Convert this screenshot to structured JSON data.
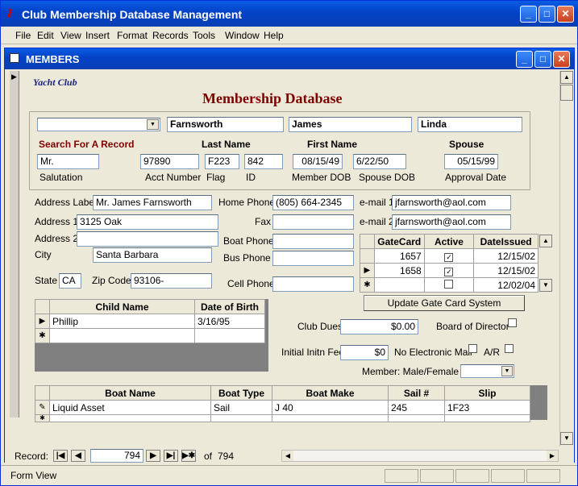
{
  "app": {
    "title": "Club Membership Database Management"
  },
  "menu": [
    "File",
    "Edit",
    "View",
    "Insert",
    "Format",
    "Records",
    "Tools",
    "Window",
    "Help"
  ],
  "window": {
    "title": "MEMBERS"
  },
  "form": {
    "club": "Yacht Club",
    "heading": "Membership Database",
    "search_label": "Search For A Record",
    "name_headers": {
      "last": "Last Name",
      "first": "First Name",
      "spouse": "Spouse"
    },
    "last_name": "Farnsworth",
    "first_name": "James",
    "spouse_name": "Linda",
    "salutation": "Mr.",
    "acct": "97890",
    "flag": "F223",
    "id": "842",
    "member_dob": "08/15/49",
    "spouse_dob": "6/22/50",
    "approval_date": "05/15/99",
    "labels": {
      "salutation": "Salutation",
      "acct": "Acct Number",
      "flag": "Flag",
      "id": "ID",
      "member_dob": "Member DOB",
      "spouse_dob": "Spouse DOB",
      "approval": "Approval Date",
      "address_label": "Address Label",
      "address1": "Address 1",
      "address2": "Address 2",
      "city": "City",
      "state": "State",
      "zip": "Zip Code",
      "home_phone": "Home Phone",
      "fax": "Fax",
      "boat_phone": "Boat Phone",
      "bus_phone": "Bus Phone",
      "cell_phone": "Cell Phone",
      "email1": "e-mail 1",
      "email2": "e-mail 2",
      "club_dues": "Club Dues",
      "board": "Board of Director",
      "initial_fee": "Initial Initn Fee",
      "no_email": "No Electronic Mail",
      "ar": "A/R",
      "gender": "Member: Male/Female"
    },
    "address_label": "Mr. James Farnsworth",
    "address1": "3125 Oak",
    "address2": "",
    "city": "Santa Barbara",
    "state": "CA",
    "zip": "93106-",
    "home_phone": "(805) 664-2345",
    "fax": "",
    "boat_phone": "",
    "bus_phone": "",
    "cell_phone": "",
    "email1": "jfarnsworth@aol.com",
    "email2": "jfarnsworth@aol.com",
    "club_dues": "$0.00",
    "initial_fee": "$0",
    "update_button": "Update Gate Card System",
    "gate": {
      "headers": [
        "GateCard",
        "Active",
        "DateIssued"
      ],
      "rows": [
        [
          "1657",
          "✓",
          "12/15/02"
        ],
        [
          "1658",
          "✓",
          "12/15/02"
        ],
        [
          "",
          "",
          "12/02/04"
        ]
      ]
    },
    "child": {
      "headers": [
        "Child Name",
        "Date of Birth"
      ],
      "rows": [
        [
          "Phillip",
          "3/16/95"
        ],
        [
          "",
          ""
        ]
      ]
    },
    "boat": {
      "headers": [
        "Boat Name",
        "Boat Type",
        "Boat Make",
        "Sail #",
        "Slip"
      ],
      "rows": [
        [
          "Liquid Asset",
          "Sail",
          "J 40",
          "245",
          "1F23"
        ],
        [
          "",
          "",
          "",
          "",
          ""
        ]
      ]
    }
  },
  "record": {
    "label": "Record:",
    "current": "794",
    "of": "of",
    "total": "794"
  },
  "status": {
    "text": "Form View"
  }
}
